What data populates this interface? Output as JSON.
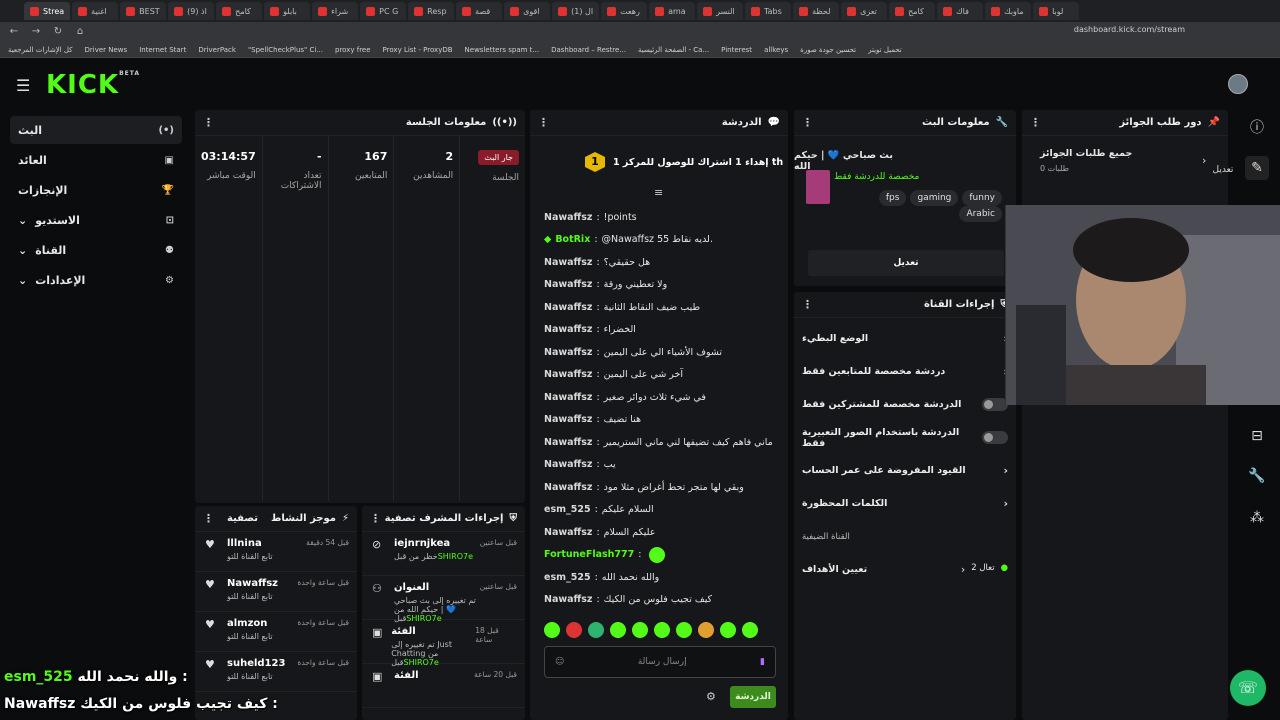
{
  "browser": {
    "tabs": [
      "Strea",
      "اغنية",
      "BEST",
      "(9) اذ",
      "كامح",
      "بابلو",
      "شراء",
      "PC G",
      "Resp",
      "قصة",
      "اقوى",
      "(1) ال",
      "رهعت",
      "ama",
      "النسر",
      "Tabs",
      "لحظة",
      "تعزى",
      "كامح",
      "فاك",
      "ماوبك",
      "لوبا"
    ],
    "url": "dashboard.kick.com/stream",
    "bookmarks": [
      "كل الإشارات المرجعية",
      "Driver News",
      "Internet Start",
      "DriverPack",
      "\"SpellCheckPlus\" Ci...",
      "proxy free",
      "Proxy List - ProxyDB",
      "Newsletters spam t...",
      "Dashboard – Restre...",
      "الصفحة الرئيسية - Ca...",
      "Pinterest",
      "allkeys",
      "تحسين جودة صورة",
      "تحميل تويتر"
    ]
  },
  "app": {
    "logo": "KICK",
    "logo_badge": "BETA"
  },
  "sidebar": {
    "items": [
      {
        "label": "البث",
        "icon": "(•)"
      },
      {
        "label": "العائد",
        "icon": "▣"
      },
      {
        "label": "الإنجازات",
        "icon": "🏆"
      },
      {
        "label": "الاستديو",
        "icon": "⊡"
      },
      {
        "label": "القناة",
        "icon": "⚉"
      },
      {
        "label": "الإعدادات",
        "icon": "⚙"
      }
    ]
  },
  "session": {
    "title": "معلومات الجلسة",
    "live_badge": "جار البث",
    "stats": [
      {
        "value": "03:14:57",
        "label": "الوقت مباشر"
      },
      {
        "value": "-",
        "label": "تعداد الاشتراكات"
      },
      {
        "value": "167",
        "label": "المتابعين"
      },
      {
        "value": "2",
        "label": "المشاهدين"
      },
      {
        "value": "",
        "label": "الجلسة"
      }
    ]
  },
  "activity": {
    "title": "موجز النشاط",
    "filter": "تصفية",
    "rows": [
      {
        "name": "lllnina",
        "sub": "تابع القناة للتو",
        "time": "قبل 54 دقيقة"
      },
      {
        "name": "Nawaffsz",
        "sub": "تابع القناة للتو",
        "time": "قبل ساعة واحدة"
      },
      {
        "name": "almzon",
        "sub": "تابع القناة للتو",
        "time": "قبل ساعة واحدة"
      },
      {
        "name": "suheld123",
        "sub": "تابع القناة للتو",
        "time": "قبل ساعة واحدة"
      }
    ]
  },
  "mod": {
    "title": "إجراءات المشرف",
    "filter": "تصفية",
    "rows": [
      {
        "name": "iejnrnjkea",
        "sub": "خظر من قبل",
        "by": "SHIRO7e",
        "time": "قبل ساعتين"
      },
      {
        "name": "العنوان",
        "sub": "تم تغييره إلى بث صباحي 💙 | حيكم الله من قبل",
        "by": "SHIRO7e",
        "time": "قبل ساعتين"
      },
      {
        "name": "الفئة",
        "sub": "تم تغييره إلى Just Chatting من قبل",
        "by": "SHIRO7e",
        "time": "قبل 18 ساعة"
      },
      {
        "name": "الفئة",
        "sub": "",
        "by": "",
        "time": "قبل 20 ساعة"
      }
    ]
  },
  "chat": {
    "title": "الدردشة",
    "pinned": "إهداء 1 اشتراك للوصول للمركز 1 th",
    "pinned_rank": "1",
    "messages": [
      {
        "user": "Nawaffsz",
        "text": "!points",
        "color": "default"
      },
      {
        "user": "BotRix",
        "text": "@Nawaffsz لديه نقاط 55.",
        "color": "green"
      },
      {
        "user": "Nawaffsz",
        "text": "هل حقيقي؟",
        "color": "default"
      },
      {
        "user": "Nawaffsz",
        "text": "ولا تعطيني ورقة",
        "color": "default"
      },
      {
        "user": "Nawaffsz",
        "text": "طيب ضيف النقاط الثانية",
        "color": "default"
      },
      {
        "user": "Nawaffsz",
        "text": "الخضراء",
        "color": "default"
      },
      {
        "user": "Nawaffsz",
        "text": "تشوف الأشياء الي على اليمين",
        "color": "default"
      },
      {
        "user": "Nawaffsz",
        "text": "آخر شي على اليمين",
        "color": "default"
      },
      {
        "user": "Nawaffsz",
        "text": "في شيء ثلاث دوائر صغير",
        "color": "default"
      },
      {
        "user": "Nawaffsz",
        "text": "هنا تضيف",
        "color": "default"
      },
      {
        "user": "Nawaffsz",
        "text": "ماني فاهم كيف تضيفها لني ماني الستريمير",
        "color": "default"
      },
      {
        "user": "Nawaffsz",
        "text": "يب",
        "color": "default"
      },
      {
        "user": "Nawaffsz",
        "text": "وبقي لها متجر تحط أغراض مثلا مود",
        "color": "default"
      },
      {
        "user": "esm_525",
        "text": "السلام عليكم",
        "color": "default"
      },
      {
        "user": "Nawaffsz",
        "text": "عليكم السلام",
        "color": "default"
      },
      {
        "user": "FortuneFlash777",
        "text": "",
        "color": "green"
      },
      {
        "user": "esm_525",
        "text": "والله نحمد الله",
        "color": "default"
      },
      {
        "user": "Nawaffsz",
        "text": "كيف تجيب فلوس من الكيك",
        "color": "default"
      }
    ],
    "input_placeholder": "إرسال رسالة",
    "send_label": "الدردشة"
  },
  "stream_info": {
    "title": "معلومات البث",
    "stream_title": "بث صباحي 💙 | حيكم الله",
    "category": "مخصصة للدردشة فقط",
    "tags": [
      "funny",
      "gaming",
      "fps",
      "Arabic"
    ],
    "edit_label": "تعديل"
  },
  "channel_actions": {
    "title": "إجراءات القناة",
    "rows": [
      {
        "label": "الوضع البطيء",
        "type": "chevron"
      },
      {
        "label": "دردشة مخصصة للمتابعين فقط",
        "type": "chevron"
      },
      {
        "label": "الدردشة مخصصة للمشتركين فقط",
        "type": "toggle"
      },
      {
        "label": "الدردشة باستخدام الصور التعبيرية فقط",
        "type": "toggle"
      },
      {
        "label": "القيود المفروضة على عمر الحساب",
        "type": "chevron"
      },
      {
        "label": "الكلمات المحظورة",
        "type": "chevron"
      },
      {
        "label": "القناة الضيفية",
        "type": "none"
      },
      {
        "label": "تعيين الأهداف",
        "type": "goal",
        "extra": "تعال 2"
      }
    ]
  },
  "rewards": {
    "title": "دور طلب الجوائز",
    "all_label": "جميع طلبات الجوائز",
    "count_label": "طلبات 0",
    "edit_label": "تعديل"
  },
  "overlay": {
    "line1_user": "esm_525",
    "line1_text": "والله نحمد الله :",
    "line2_user": "Nawaffsz",
    "line2_text": "كيف تجيب فلوس من الكيك :"
  }
}
